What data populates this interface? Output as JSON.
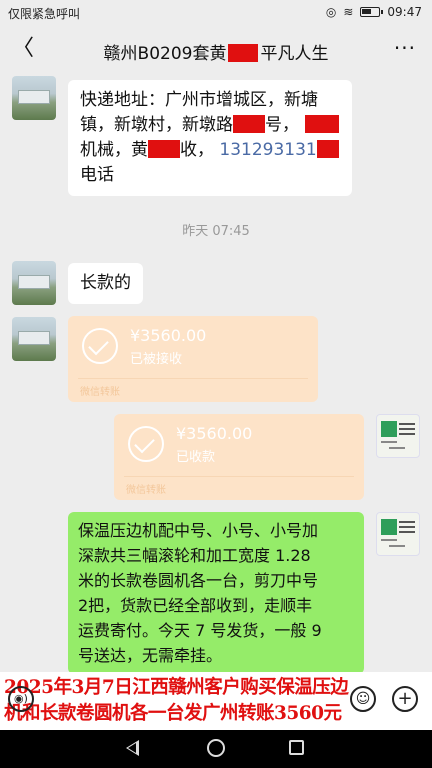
{
  "status": {
    "left_text": "仅限紧急呼叫",
    "time": "09:47"
  },
  "header": {
    "back_glyph": "〈",
    "title_prefix": "赣州B0209套黄",
    "title_suffix": "平凡人生",
    "more_glyph": "···"
  },
  "messages": {
    "address": {
      "line1": "快递地址：广州市增城区，新塘",
      "line2a": "镇，新墩村，新墩路",
      "line2b": "号，",
      "line3a": "机械，黄",
      "line3b": "收，",
      "phone": "131293131",
      "line4": "电话"
    },
    "timestamp": "昨天 07:45",
    "long_model": "长款的",
    "transfer_received": {
      "amount": "¥3560.00",
      "status": "已被接收",
      "footer": "微信转账"
    },
    "transfer_sent": {
      "amount": "¥3560.00",
      "status": "已收款",
      "footer": "微信转账"
    },
    "order": {
      "line1": "保温压边机配中号、小号、小号加",
      "line2": "深款共三幅滚轮和加工宽度 1.28",
      "line3": "米的长款卷圆机各一台，剪刀中号",
      "line4": "2把，货款已经全部收到，走顺丰",
      "line5": "运费寄付。今天 7 号发货，一般 9",
      "line6": "号送达，无需牵挂。"
    }
  },
  "banner": {
    "line1": "2025年3月7日江西赣州客户购买保温压边",
    "line2": "机和长款卷圆机各一台发广州转账3560元"
  },
  "input": {
    "voice_glyph": "◉)",
    "emoji_glyph": "☺",
    "plus_glyph": "+"
  },
  "colors": {
    "bubble_green": "#95ec69",
    "transfer_bg": "#fde3c8",
    "redaction": "#e01010",
    "background": "#ededed"
  }
}
